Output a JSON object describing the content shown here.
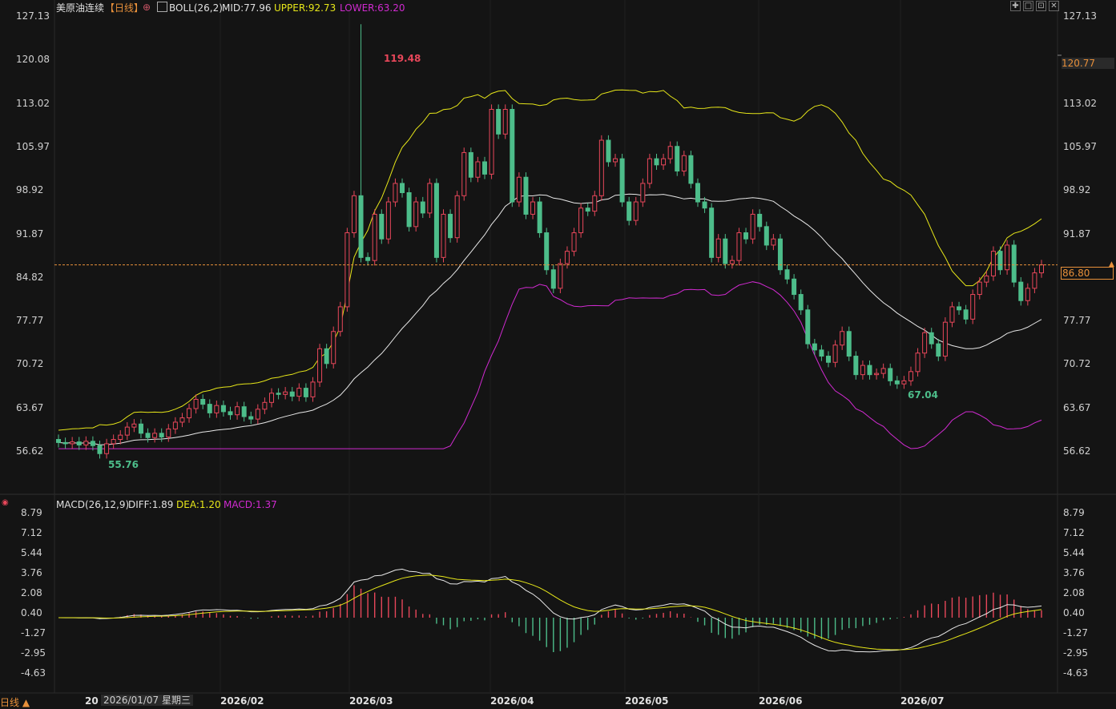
{
  "header": {
    "symbol": "美原油连续",
    "period": "【日线】",
    "boll_text": "BOLL(26,2)",
    "mid_text": "MID:77.96",
    "upper_text": "UPPER:92.73",
    "lower_text": "LOWER:63.20"
  },
  "macd_header": {
    "title": "MACD(26,12,9)",
    "diff_text": "DIFF:1.89",
    "dea_text": "DEA:1.20",
    "macd_text": "MACD:1.37"
  },
  "price_axis": {
    "left_ticks": [
      "127.13",
      "120.08",
      "113.02",
      "105.97",
      "98.92",
      "91.87",
      "84.82",
      "77.77",
      "70.72",
      "63.67",
      "56.62"
    ],
    "right_ticks": [
      "127.13",
      "120.77",
      "113.02",
      "105.97",
      "98.92",
      "91.87",
      "86.80",
      "77.77",
      "70.72",
      "63.67",
      "56.62"
    ]
  },
  "macd_axis": {
    "ticks": [
      "8.79",
      "7.12",
      "5.44",
      "3.76",
      "2.08",
      "0.40",
      "-1.27",
      "-2.95",
      "-4.63"
    ]
  },
  "time_axis": {
    "labels": [
      "2026/02",
      "2026/03",
      "2026/04",
      "2026/05",
      "2026/06",
      "2026/07"
    ],
    "partial_label": "20",
    "crosshair_date": "2026/01/07 星期三"
  },
  "footer": {
    "period_button": "日线 ▲"
  },
  "markers": {
    "high_label": "119.48",
    "low_label": "55.76",
    "local_low_label": "67.04",
    "last_price": "86.80",
    "crosshair_price": "120.77"
  },
  "colors": {
    "up": "#e8475a",
    "down": "#4dbd8a",
    "mid": "#e8e8e8",
    "upper": "#e6e619",
    "lower": "#d02ad0",
    "dea": "#e6e619",
    "diff": "#e8e8e8",
    "last_price": "#e8903a"
  },
  "chart_data": [
    {
      "type": "candlestick",
      "title": "美原油连续",
      "indicator": "BOLL(26,2)",
      "ylim": [
        55.76,
        127.13
      ],
      "series": [
        {
          "name": "MID",
          "values": [
            77.96
          ]
        },
        {
          "name": "UPPER",
          "values": [
            92.73
          ]
        },
        {
          "name": "LOWER",
          "values": [
            63.2
          ]
        }
      ],
      "x": [
        "2026/01",
        "2026/02",
        "2026/03",
        "2026/04",
        "2026/05",
        "2026/06",
        "2026/07"
      ],
      "annotations": {
        "max": 119.48,
        "min": 55.76,
        "local_min": 67.04,
        "last": 86.8
      }
    },
    {
      "type": "bar",
      "title": "MACD(26,12,9)",
      "ylim": [
        -4.63,
        8.79
      ],
      "series": [
        {
          "name": "DIFF",
          "values": [
            1.89
          ]
        },
        {
          "name": "DEA",
          "values": [
            1.2
          ]
        },
        {
          "name": "MACD",
          "values": [
            1.37
          ]
        }
      ]
    }
  ]
}
